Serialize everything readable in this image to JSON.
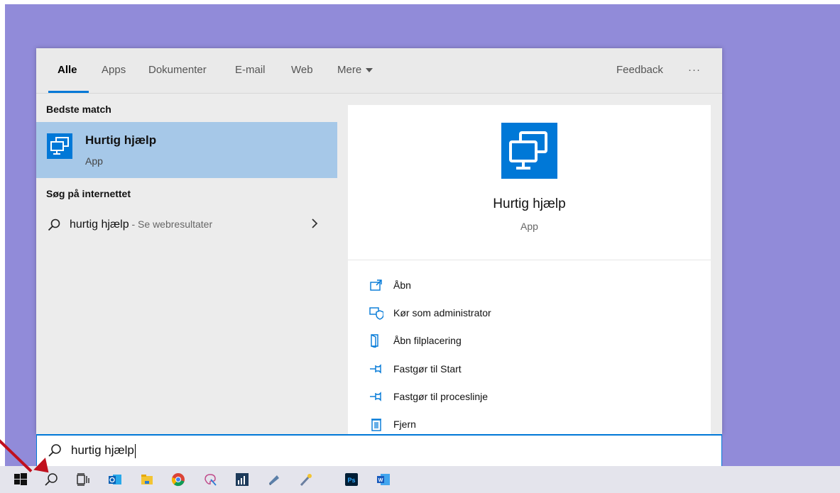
{
  "tabs": {
    "items": [
      {
        "label": "Alle",
        "active": true
      },
      {
        "label": "Apps"
      },
      {
        "label": "Dokumenter"
      },
      {
        "label": "E-mail"
      },
      {
        "label": "Web"
      },
      {
        "label": "Mere"
      }
    ],
    "feedback": "Feedback",
    "more_options": "···"
  },
  "left": {
    "best_match_title": "Bedste match",
    "best_match": {
      "name": "Hurtig hjælp",
      "type": "App",
      "icon": "remote-desktop-icon"
    },
    "web_title": "Søg på internettet",
    "web_result": {
      "query": "hurtig hjælp",
      "suffix": " - Se webresultater"
    }
  },
  "preview": {
    "name": "Hurtig hjælp",
    "type": "App",
    "actions": [
      {
        "label": "Åbn",
        "icon": "open-icon"
      },
      {
        "label": "Kør som administrator",
        "icon": "run-as-admin-icon"
      },
      {
        "label": "Åbn filplacering",
        "icon": "file-location-icon"
      },
      {
        "label": "Fastgør til Start",
        "icon": "pin-icon"
      },
      {
        "label": "Fastgør til proceslinje",
        "icon": "pin-icon"
      },
      {
        "label": "Fjern",
        "icon": "trash-icon"
      }
    ]
  },
  "search": {
    "value": "hurtig hjælp"
  },
  "taskbar": {
    "items": [
      "windows-start-icon",
      "search-icon",
      "task-view-icon",
      "outlook-icon",
      "file-explorer-icon",
      "chrome-icon",
      "paint-icon",
      "stats-icon",
      "app-icon",
      "pencil-app-icon",
      "photoshop-icon",
      "word-icon"
    ]
  },
  "colors": {
    "accent": "#0078d7",
    "desktop": "#918bd9",
    "highlight": "#a6c8e8",
    "arrow": "#c0101e"
  }
}
